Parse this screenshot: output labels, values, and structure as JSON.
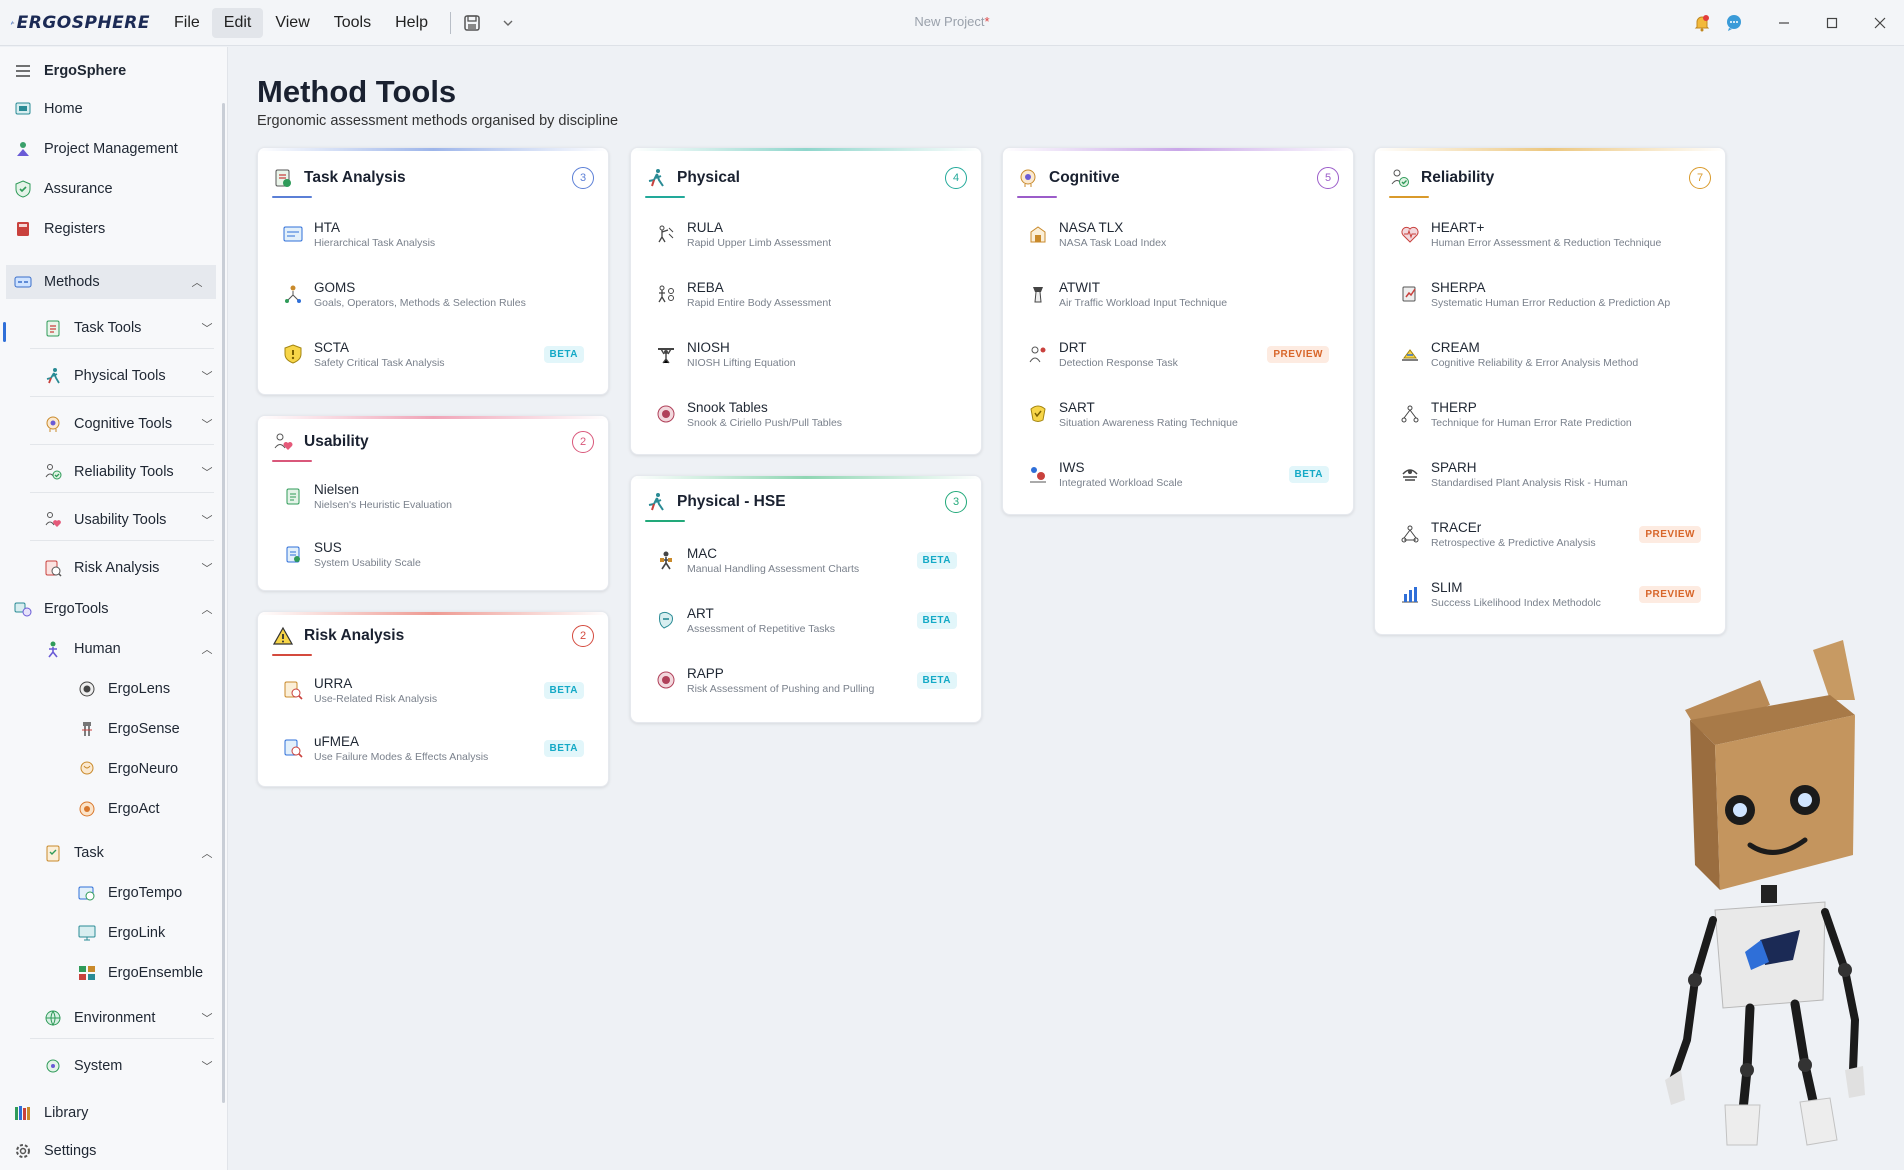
{
  "app": {
    "logo_text": "ERGOSPHERE",
    "document_title": "New Project",
    "unsaved_marker": "*",
    "menu": [
      "File",
      "Edit",
      "View",
      "Tools",
      "Help"
    ],
    "active_menu": "Edit"
  },
  "sidebar": {
    "header": "ErgoSphere",
    "items": [
      {
        "label": "Home"
      },
      {
        "label": "Project Management"
      },
      {
        "label": "Assurance"
      },
      {
        "label": "Registers"
      },
      {
        "label": "Methods"
      },
      {
        "label": "Task Tools"
      },
      {
        "label": "Physical Tools"
      },
      {
        "label": "Cognitive Tools"
      },
      {
        "label": "Reliability Tools"
      },
      {
        "label": "Usability Tools"
      },
      {
        "label": "Risk Analysis"
      },
      {
        "label": "ErgoTools"
      },
      {
        "label": "Human"
      },
      {
        "label": "ErgoLens"
      },
      {
        "label": "ErgoSense"
      },
      {
        "label": "ErgoNeuro"
      },
      {
        "label": "ErgoAct"
      },
      {
        "label": "Task"
      },
      {
        "label": "ErgoTempo"
      },
      {
        "label": "ErgoLink"
      },
      {
        "label": "ErgoEnsemble"
      },
      {
        "label": "Environment"
      },
      {
        "label": "System"
      },
      {
        "label": "Library"
      },
      {
        "label": "Settings"
      }
    ]
  },
  "page": {
    "title": "Method Tools",
    "subtitle": "Ergonomic assessment methods organised by discipline"
  },
  "cards": {
    "task_analysis": {
      "title": "Task Analysis",
      "count": "3",
      "accent": "#5b7fd6",
      "tools": [
        {
          "name": "HTA",
          "desc": "Hierarchical Task Analysis",
          "badge": ""
        },
        {
          "name": "GOMS",
          "desc": "Goals, Operators, Methods & Selection Rules",
          "badge": ""
        },
        {
          "name": "SCTA",
          "desc": "Safety Critical Task Analysis",
          "badge": "BETA"
        }
      ]
    },
    "usability": {
      "title": "Usability",
      "count": "2",
      "accent": "#d9577a",
      "tools": [
        {
          "name": "Nielsen",
          "desc": "Nielsen's Heuristic Evaluation",
          "badge": ""
        },
        {
          "name": "SUS",
          "desc": "System Usability Scale",
          "badge": ""
        }
      ]
    },
    "risk_analysis": {
      "title": "Risk Analysis",
      "count": "2",
      "accent": "#d44a3e",
      "tools": [
        {
          "name": "URRA",
          "desc": "Use-Related Risk Analysis",
          "badge": "BETA"
        },
        {
          "name": "uFMEA",
          "desc": "Use Failure Modes & Effects Analysis",
          "badge": "BETA"
        }
      ]
    },
    "physical": {
      "title": "Physical",
      "count": "4",
      "accent": "#22a99a",
      "tools": [
        {
          "name": "RULA",
          "desc": "Rapid Upper Limb Assessment",
          "badge": ""
        },
        {
          "name": "REBA",
          "desc": "Rapid Entire Body Assessment",
          "badge": ""
        },
        {
          "name": "NIOSH",
          "desc": "NIOSH Lifting Equation",
          "badge": ""
        },
        {
          "name": "Snook Tables",
          "desc": "Snook & Ciriello Push/Pull Tables",
          "badge": ""
        }
      ]
    },
    "physical_hse": {
      "title": "Physical - HSE",
      "count": "3",
      "accent": "#22a97a",
      "tools": [
        {
          "name": "MAC",
          "desc": "Manual Handling Assessment Charts",
          "badge": "BETA"
        },
        {
          "name": "ART",
          "desc": "Assessment of Repetitive Tasks",
          "badge": "BETA"
        },
        {
          "name": "RAPP",
          "desc": "Risk Assessment of Pushing and Pulling",
          "badge": "BETA"
        }
      ]
    },
    "cognitive": {
      "title": "Cognitive",
      "count": "5",
      "accent": "#9b5cc9",
      "tools": [
        {
          "name": "NASA TLX",
          "desc": "NASA Task Load Index",
          "badge": ""
        },
        {
          "name": "ATWIT",
          "desc": "Air Traffic Workload Input Technique",
          "badge": ""
        },
        {
          "name": "DRT",
          "desc": "Detection Response Task",
          "badge": "PREVIEW"
        },
        {
          "name": "SART",
          "desc": "Situation Awareness Rating Technique",
          "badge": ""
        },
        {
          "name": "IWS",
          "desc": "Integrated Workload Scale",
          "badge": "BETA"
        }
      ]
    },
    "reliability": {
      "title": "Reliability",
      "count": "7",
      "accent": "#d99a2b",
      "tools": [
        {
          "name": "HEART+",
          "desc": "Human Error Assessment & Reduction Technique",
          "badge": ""
        },
        {
          "name": "SHERPA",
          "desc": "Systematic Human Error Reduction & Prediction Ap",
          "badge": ""
        },
        {
          "name": "CREAM",
          "desc": "Cognitive Reliability & Error Analysis Method",
          "badge": ""
        },
        {
          "name": "THERP",
          "desc": "Technique for Human Error Rate Prediction",
          "badge": ""
        },
        {
          "name": "SPARH",
          "desc": "Standardised Plant Analysis Risk - Human",
          "badge": ""
        },
        {
          "name": "TRACEr",
          "desc": "Retrospective & Predictive Analysis",
          "badge": "PREVIEW"
        },
        {
          "name": "SLIM",
          "desc": "Success Likelihood Index Methodolc",
          "badge": "PREVIEW"
        }
      ]
    }
  }
}
